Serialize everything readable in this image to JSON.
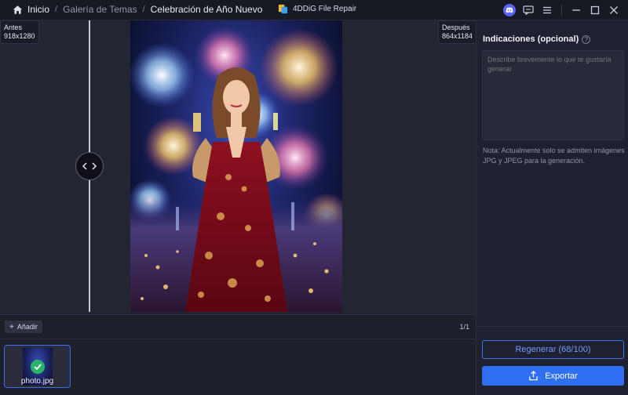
{
  "breadcrumb": {
    "home": "Inicio",
    "separator": "/",
    "gallery": "Galería de Temas",
    "current": "Celebración de Año Nuevo"
  },
  "app": {
    "title": "4DDiG File Repair"
  },
  "window_icons": [
    "discord-icon",
    "feedback-icon",
    "menu-icon",
    "minimize-icon",
    "maximize-icon",
    "close-icon"
  ],
  "preview": {
    "before_label": "Antes",
    "before_size": "918x1280",
    "after_label": "Después",
    "after_size": "864x1184"
  },
  "toolbar": {
    "add_label": "Añadir",
    "page_count": "1/1"
  },
  "thumbnail": {
    "filename": "photo.jpg"
  },
  "side": {
    "title": "Indicaciones (opcional)",
    "placeholder": "Describe brevemente lo que te gustaría generar",
    "note": "Nota: Actualmente solo se admiten imágenes JPG y JPEG para la generación.",
    "regenerate": "Regenerar (68/100)",
    "export": "Exportar"
  },
  "colors": {
    "accent": "#2f6ff2",
    "background": "#1d1f2b",
    "success": "#29b46a"
  }
}
